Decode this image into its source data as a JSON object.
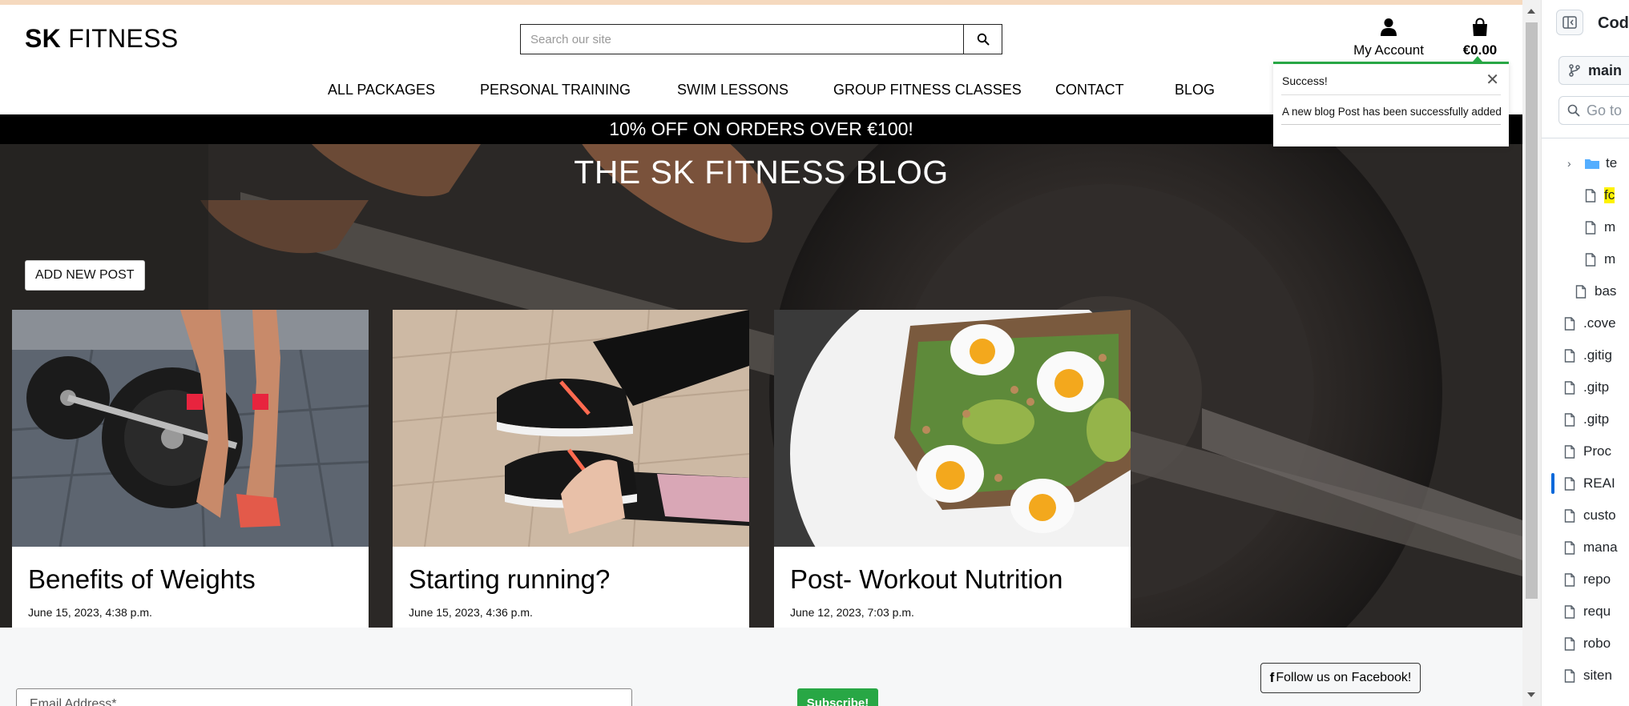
{
  "site": {
    "logo_bold": "SK",
    "logo_rest": " FITNESS",
    "search_placeholder": "Search our site",
    "account_label": "My Account",
    "cart_total": "€0.00"
  },
  "nav": [
    "ALL PACKAGES",
    "PERSONAL TRAINING",
    "SWIM LESSONS",
    "GROUP FITNESS CLASSES",
    "CONTACT",
    "BLOG"
  ],
  "promo": "10% OFF ON ORDERS OVER €100!",
  "blog": {
    "title": "THE SK FITNESS BLOG",
    "add_button": "ADD NEW POST",
    "posts": [
      {
        "title": "Benefits of Weights",
        "date": "June 15, 2023, 4:38 p.m."
      },
      {
        "title": "Starting running?",
        "date": "June 15, 2023, 4:36 p.m."
      },
      {
        "title": "Post- Workout Nutrition",
        "date": "June 12, 2023, 7:03 p.m."
      }
    ]
  },
  "toast": {
    "heading": "Success!",
    "close": "✕",
    "message": "A new blog Post has been successfully added"
  },
  "footer": {
    "email_placeholder": "Email Address*",
    "subscribe": "Subscribe!",
    "facebook": "Follow us on Facebook!"
  },
  "ide": {
    "title": "Code",
    "branch": "main",
    "goto_placeholder": "Go to",
    "tree": [
      {
        "name": "te",
        "type": "folder",
        "expanded": false
      },
      {
        "name": "fc",
        "type": "file",
        "highlight": true
      },
      {
        "name": "m",
        "type": "file"
      },
      {
        "name": "m",
        "type": "file"
      },
      {
        "name": "bas",
        "type": "file"
      },
      {
        "name": ".cove",
        "type": "file"
      },
      {
        "name": ".gitig",
        "type": "file"
      },
      {
        "name": ".gitp",
        "type": "file"
      },
      {
        "name": ".gitp",
        "type": "file"
      },
      {
        "name": "Proc",
        "type": "file"
      },
      {
        "name": "REAI",
        "type": "file",
        "active": true
      },
      {
        "name": "custo",
        "type": "file"
      },
      {
        "name": "mana",
        "type": "file"
      },
      {
        "name": "repo",
        "type": "file"
      },
      {
        "name": "requ",
        "type": "file"
      },
      {
        "name": "robo",
        "type": "file"
      },
      {
        "name": "siten",
        "type": "file"
      }
    ]
  },
  "colors": {
    "success": "#28a745",
    "promo_bg": "#000000",
    "accent_top": "#f5d9be",
    "ide_active": "#0969da"
  }
}
